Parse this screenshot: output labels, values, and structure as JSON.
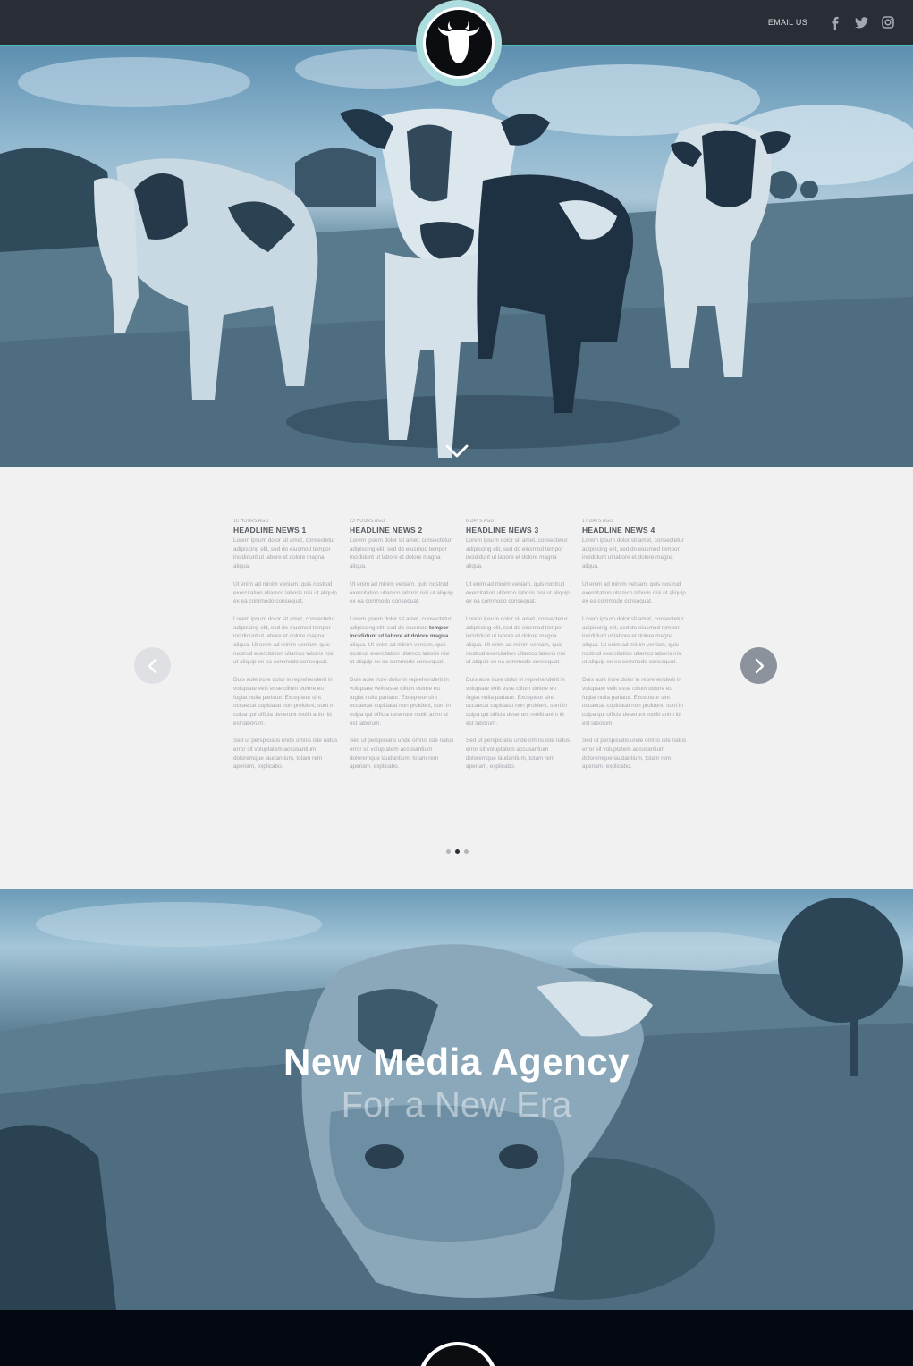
{
  "header": {
    "email_label": "EMAIL US",
    "social_icons": [
      "facebook-icon",
      "twitter-icon",
      "instagram-icon"
    ],
    "accent_color": "#4fb8b0",
    "bar_color": "#292d35"
  },
  "hero": {
    "scroll_icon": "chevron-down-icon"
  },
  "news": {
    "items": [
      {
        "time": "10 hours ago",
        "headline": "HEADLINE NEWS 1",
        "p1": "Lorem ipsum dolor sit amet, consectetur adipiscing elit, sed do eiusmod tempor incididunt ut labore et dolore magna aliqua.",
        "p2": "Ut enim ad minim veniam, quis nostrud exercitation ullamco laboris nisi ut aliquip ex ea commodo consequat.",
        "p3": "Lorem ipsum dolor sit amet, consectetur adipiscing elit, sed do eiusmod tempor incididunt ut labore et dolore magna aliqua. Ut enim ad minim veniam, quis nostrud exercitation ullamco laboris nisi ut aliquip ex ea commodo consequat.",
        "p4": "Duis aute irure dolor in reprehenderit in voluptate velit esse cillum dolore eu fugiat nulla pariatur. Excepteur sint occaecat cupidatat non proident, sunt in culpa qui officia deserunt mollit anim id est laborum.",
        "p5": " Sed ut perspiciatis unde omnis iste natus error sit voluptatem accusantium doloremque laudantium, totam rem aperiam, explicabo."
      },
      {
        "time": "23 hours ago",
        "headline": "HEADLINE NEWS 2",
        "p1": "Lorem ipsum dolor sit amet, consectetur adipiscing elit, sed do eiusmod tempor incididunt ut labore et dolore magna aliqua.",
        "p2": "Ut enim ad minim veniam, quis nostrud exercitation ullamco laboris nisi ut aliquip ex ea commodo consequat.",
        "p3a": "Lorem ipsum dolor sit amet, consectetur adipiscing elit, sed do eiusmod ",
        "p3b": "tempor incididunt ut labore et dolore magna",
        "p3c": " aliqua. Ut enim ad minim veniam, quis nostrud exercitation ullamco laboris nisi ut aliquip ex ea commodo consequat.",
        "p4": "Duis aute irure dolor in reprehenderit in voluptate velit esse cillum dolore eu fugiat nulla pariatur. Excepteur sint occaecat cupidatat non proident, sunt in culpa qui officia deserunt mollit anim id est laborum.",
        "p5": " Sed ut perspiciatis unde omnis iste natus error sit voluptatem accusantium doloremque laudantium, totam rem aperiam, explicabo."
      },
      {
        "time": "6 days ago",
        "headline": "HEADLINE NEWS 3",
        "p1": "Lorem ipsum dolor sit amet, consectetur adipiscing elit, sed do eiusmod tempor incididunt ut labore et dolore magna aliqua.",
        "p2": "Ut enim ad minim veniam, quis nostrud exercitation ullamco laboris nisi ut aliquip ex ea commodo consequat.",
        "p3": "Lorem ipsum dolor sit amet, consectetur adipiscing elit, sed do eiusmod tempor incididunt ut labore et dolore magna aliqua. Ut enim ad minim veniam, quis nostrud exercitation ullamco laboris nisi ut aliquip ex ea commodo consequat.",
        "p4": "Duis aute irure dolor in reprehenderit in voluptate velit esse cillum dolore eu fugiat nulla pariatur. Excepteur sint occaecat cupidatat non proident, sunt in culpa qui officia deserunt mollit anim id est laborum.",
        "p5": " Sed ut perspiciatis unde omnis iste natus error sit voluptatem accusantium doloremque laudantium, totam rem aperiam, explicabo."
      },
      {
        "time": "17 days ago",
        "headline": "HEADLINE NEWS 4",
        "p1": "Lorem ipsum dolor sit amet, consectetur adipiscing elit, sed do eiusmod tempor incididunt ut labore et dolore magna aliqua.",
        "p2": "Ut enim ad minim veniam, quis nostrud exercitation ullamco laboris nisi ut aliquip ex ea commodo consequat.",
        "p3": "Lorem ipsum dolor sit amet, consectetur adipiscing elit, sed do eiusmod tempor incididunt ut labore et dolore magna aliqua. Ut enim ad minim veniam, quis nostrud exercitation ullamco laboris nisi ut aliquip ex ea commodo consequat.",
        "p4": "Duis aute irure dolor in reprehenderit in voluptate velit esse cillum dolore eu fugiat nulla pariatur. Excepteur sint occaecat cupidatat non proident, sunt in culpa qui officia deserunt mollit anim id est laborum.",
        "p5": " Sed ut perspiciatis unde omnis iste natus error sit voluptatem accusantium doloremque laudantium, totam rem aperiam, explicabo."
      }
    ],
    "prev_icon": "chevron-left-icon",
    "next_icon": "chevron-right-icon",
    "pagination": {
      "pages": 3,
      "active": 2
    }
  },
  "banner": {
    "title": "New Media Agency",
    "subtitle": "For a New Era"
  }
}
